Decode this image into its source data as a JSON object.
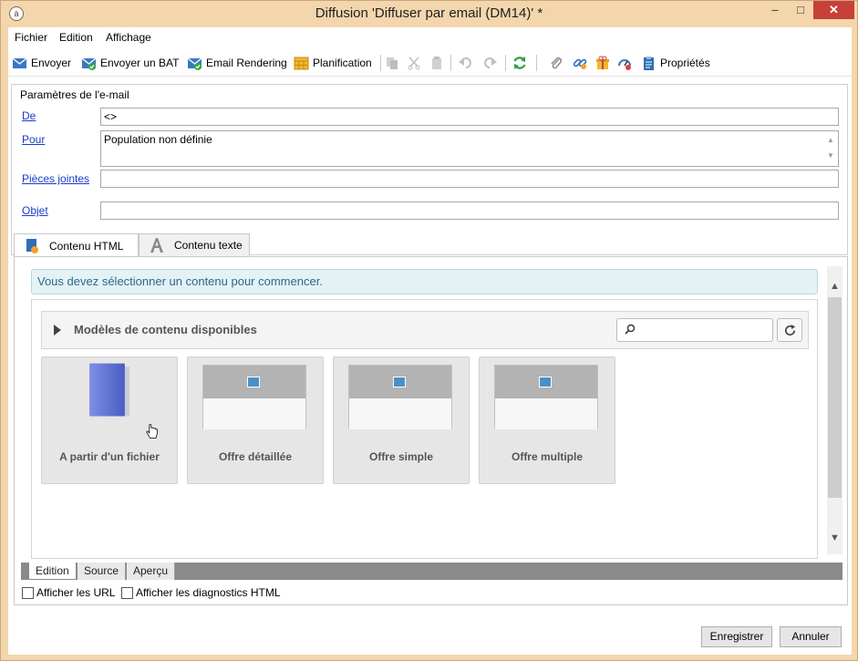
{
  "window": {
    "title": "Diffusion 'Diffuser par email (DM14)' *",
    "controls": {
      "minimize": "–",
      "maximize": "□",
      "close": "✕"
    }
  },
  "menu": [
    {
      "label": "Fichier"
    },
    {
      "label": "Edition"
    },
    {
      "label": "Affichage"
    }
  ],
  "toolbar": {
    "send": "Envoyer",
    "send_proof": "Envoyer un BAT",
    "email_rendering": "Email Rendering",
    "planning": "Planification",
    "properties": "Propriétés"
  },
  "email_params": {
    "group_title": "Paramètres de l'e-mail",
    "from_label": "De",
    "from_value": "<>",
    "to_label": "Pour",
    "to_value": "Population non définie",
    "attachments_label": "Pièces jointes",
    "attachments_value": "",
    "subject_label": "Objet",
    "subject_value": ""
  },
  "tabs": [
    {
      "label": "Contenu HTML",
      "active": true
    },
    {
      "label": "Contenu texte",
      "active": false
    }
  ],
  "content": {
    "info_message": "Vous devez sélectionner un contenu pour commencer.",
    "templates_title": "Modèles de contenu disponibles",
    "search_placeholder": "",
    "cards": [
      {
        "label": "A partir d'un fichier"
      },
      {
        "label": "Offre détaillée"
      },
      {
        "label": "Offre simple"
      },
      {
        "label": "Offre multiple"
      }
    ]
  },
  "editor_tabs": [
    {
      "label": "Edition",
      "active": true
    },
    {
      "label": "Source",
      "active": false
    },
    {
      "label": "Aperçu",
      "active": false
    }
  ],
  "options": {
    "show_urls": "Afficher les URL",
    "show_diagnostics": "Afficher les diagnostics HTML"
  },
  "footer": {
    "save": "Enregistrer",
    "cancel": "Annuler"
  },
  "colors": {
    "window_frame": "#f4d6ad",
    "link": "#1a3cc8",
    "info_banner_bg": "#e4f2f6",
    "info_text": "#2b6a8a"
  }
}
